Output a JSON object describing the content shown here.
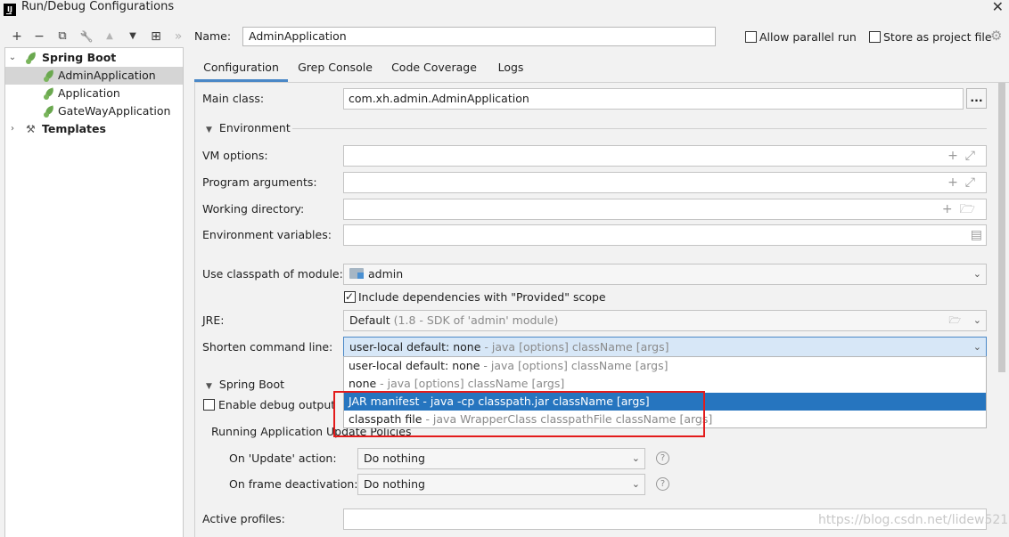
{
  "window": {
    "title": "Run/Debug Configurations",
    "app_icon": "IJ"
  },
  "toolbar": {
    "add": "+",
    "remove": "−",
    "copy": "⧉",
    "edit": "🔧",
    "up": "▲",
    "down": "▼",
    "folder": "⊞",
    "more": "»"
  },
  "tree": {
    "spring_boot": "Spring Boot",
    "items": [
      "AdminApplication",
      "Application",
      "GateWayApplication"
    ],
    "templates": "Templates"
  },
  "header": {
    "name_label": "Name:",
    "name_value": "AdminApplication",
    "allow_parallel_run": "Allow parallel run",
    "store_as_project_file": "Store as project file"
  },
  "tabs": [
    "Configuration",
    "Grep Console",
    "Code Coverage",
    "Logs"
  ],
  "form": {
    "main_class_label": "Main class:",
    "main_class_value": "com.xh.admin.AdminApplication",
    "browse": "...",
    "environment_section": "Environment",
    "vm_options_label": "VM options:",
    "program_arguments_label": "Program arguments:",
    "working_directory_label": "Working directory:",
    "environment_variables_label": "Environment variables:",
    "classpath_label": "Use classpath of module:",
    "classpath_value": "admin",
    "include_dependencies": "Include dependencies with \"Provided\" scope",
    "jre_label": "JRE:",
    "jre_value": "Default",
    "jre_hint": "(1.8 - SDK of 'admin' module)",
    "shorten_label": "Shorten command line:",
    "shorten_value": "user-local default: none",
    "shorten_hint": "- java [options] className [args]",
    "spring_boot_section": "Spring Boot",
    "enable_debug_output": "Enable debug output",
    "update_policies": "Running Application Update Policies",
    "on_update_label": "On 'Update' action:",
    "on_update_value": "Do nothing",
    "on_frame_label": "On frame deactivation:",
    "on_frame_value": "Do nothing",
    "active_profiles_label": "Active profiles:"
  },
  "dropdown_options": [
    {
      "main": "user-local default: none",
      "hint": " - java [options] className [args]"
    },
    {
      "main": "none",
      "hint": " - java [options] className [args]"
    },
    {
      "main": "JAR manifest",
      "hint": " - java -cp classpath.jar className [args]"
    },
    {
      "main": "classpath file",
      "hint": " - java WrapperClass classpathFile className [args]"
    }
  ],
  "dropdown_selected_index": 2,
  "watermark": "https://blog.csdn.net/lidew521",
  "colors": {
    "selection": "#2675bf",
    "highlight_box": "#e31b1b",
    "tab_indicator": "#4a88c7"
  }
}
